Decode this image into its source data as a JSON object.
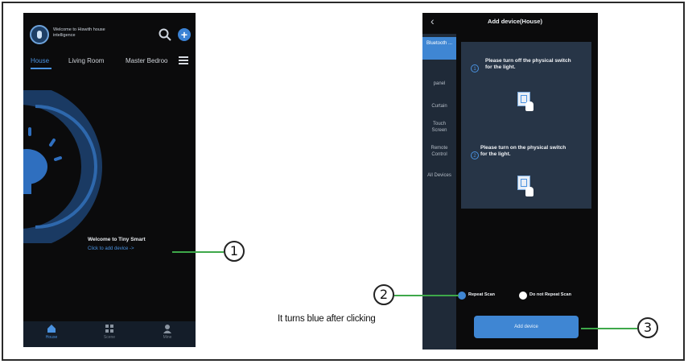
{
  "phone1": {
    "header": {
      "welcome_text": "Welcome to Hiswith house intelligence"
    },
    "tabs": [
      {
        "label": "House",
        "active": true
      },
      {
        "label": "Living Room",
        "active": false
      },
      {
        "label": "Master Bedroo",
        "active": false
      }
    ],
    "welcome": {
      "title": "Welcome to Tiny Smart",
      "link": "Click to add device ->"
    },
    "bottom_nav": [
      {
        "label": "House",
        "icon": "home-icon",
        "active": true
      },
      {
        "label": "Scene",
        "icon": "grid-icon",
        "active": false
      },
      {
        "label": "Mine",
        "icon": "user-icon",
        "active": false
      }
    ]
  },
  "phone2": {
    "title": "Add device(House)",
    "back_icon": "back-chevron-icon",
    "categories": [
      {
        "label": "Bluetooth ...",
        "active": true
      },
      {
        "label": "panel",
        "active": false
      },
      {
        "label": "Curtain",
        "active": false
      },
      {
        "label": "Touch Screen",
        "active": false
      },
      {
        "label": "Remote Control",
        "active": false
      },
      {
        "label": "All Devices",
        "active": false
      }
    ],
    "steps": [
      {
        "number": "1",
        "text": "Please turn off the physical switch for the light."
      },
      {
        "number": "2",
        "text": "Please turn on the physical switch for the light."
      }
    ],
    "options": [
      {
        "label": "Repeat Scan",
        "selected": true
      },
      {
        "label": "Do not Repeat Scan",
        "selected": false
      }
    ],
    "add_button": "Add device"
  },
  "callouts": [
    "1",
    "2",
    "3"
  ],
  "caption": "It turns blue after clicking",
  "colors": {
    "accent": "#3f86d3",
    "callout_line": "#3ea84a",
    "phone_bg": "#0b0b0c",
    "panel_bg": "#273547"
  }
}
